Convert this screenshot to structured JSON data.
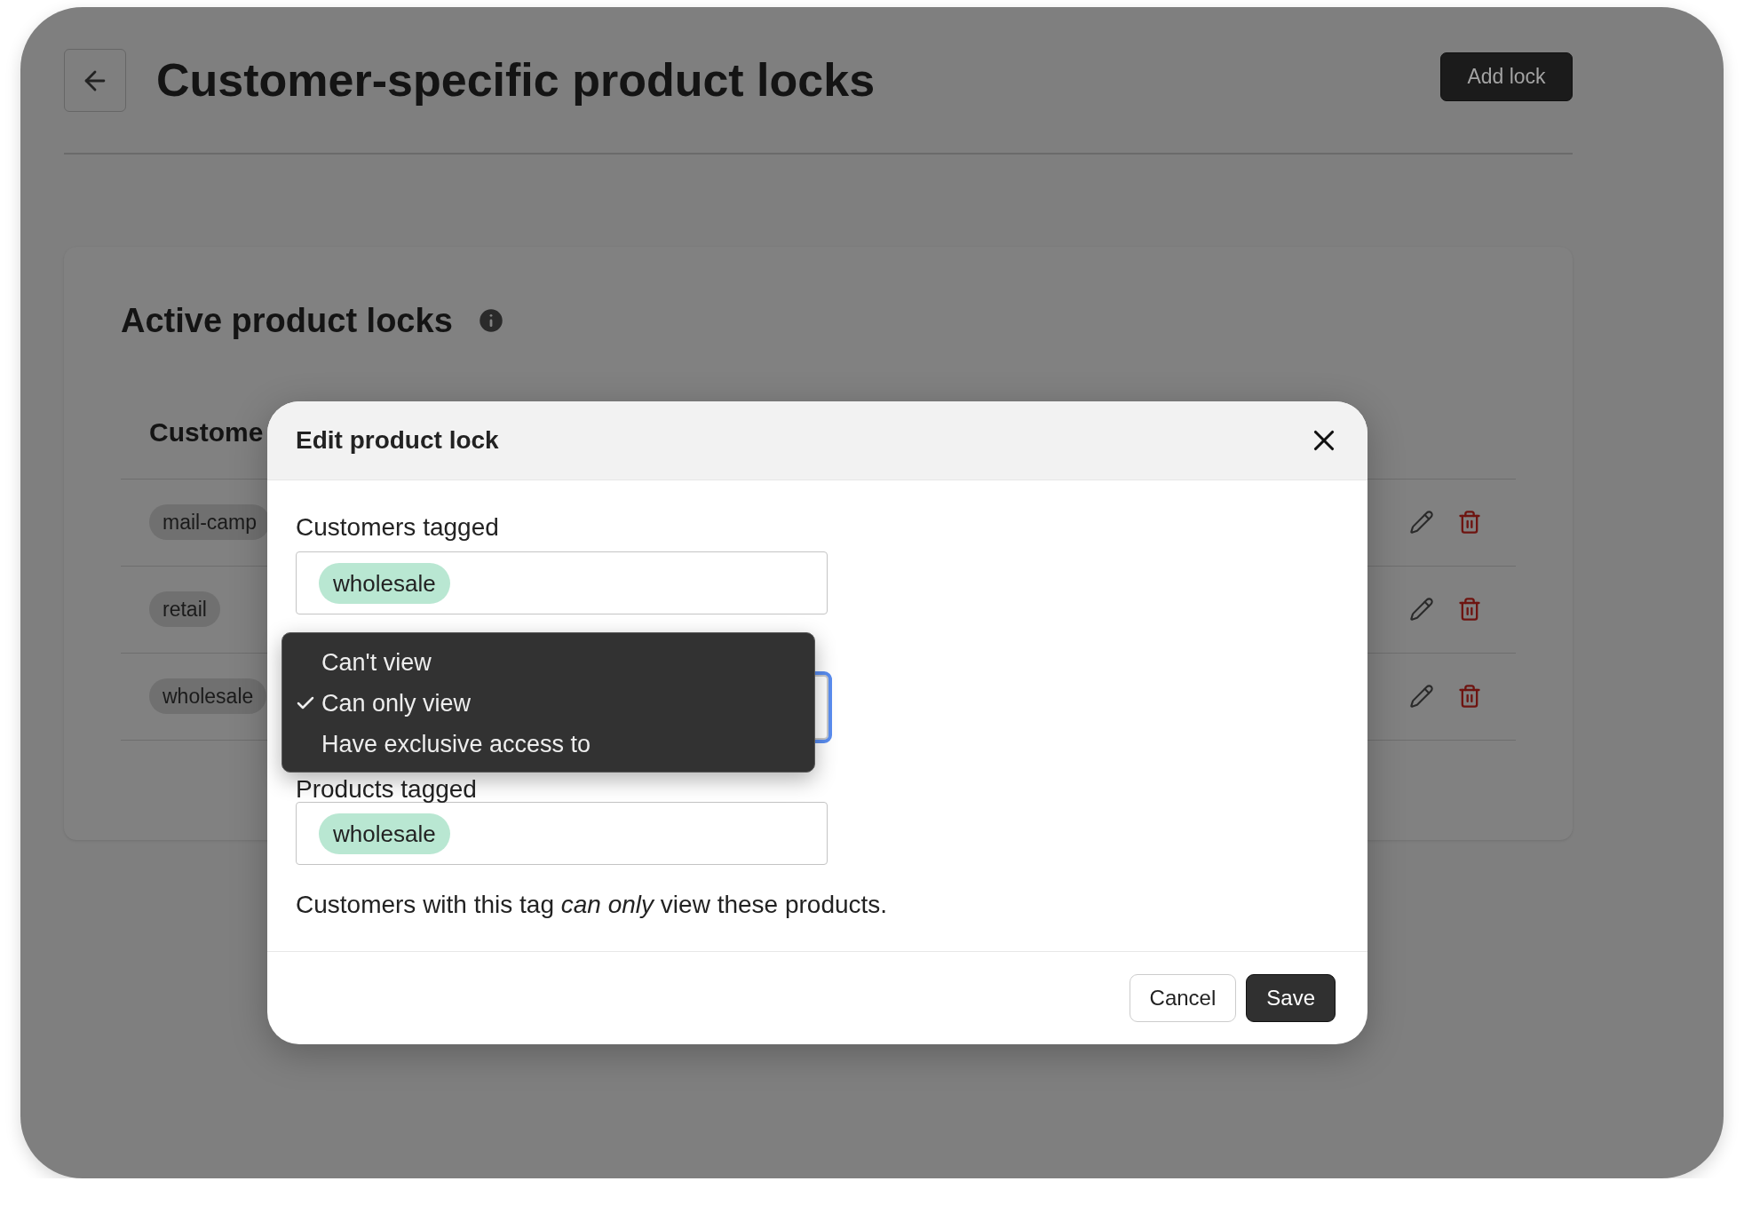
{
  "header": {
    "title": "Customer-specific product locks",
    "add_button": "Add lock"
  },
  "card": {
    "title": "Active product locks",
    "table": {
      "columns": [
        "Custome"
      ],
      "rows": [
        {
          "tag": "mail-camp"
        },
        {
          "tag": "retail"
        },
        {
          "tag": "wholesale"
        }
      ]
    }
  },
  "modal": {
    "title": "Edit product lock",
    "customers_label": "Customers tagged",
    "customer_tags": [
      "wholesale"
    ],
    "access_options": [
      {
        "label": "Can't view",
        "selected": false
      },
      {
        "label": "Can only view",
        "selected": true
      },
      {
        "label": "Have exclusive access to",
        "selected": false
      }
    ],
    "products_label": "Products tagged",
    "product_tags": [
      "wholesale"
    ],
    "help": "Customers with this tag *can only* view these products.",
    "buttons": [
      {
        "label": "Cancel",
        "kind": "secondary"
      },
      {
        "label": "Save",
        "kind": "primary"
      }
    ]
  }
}
